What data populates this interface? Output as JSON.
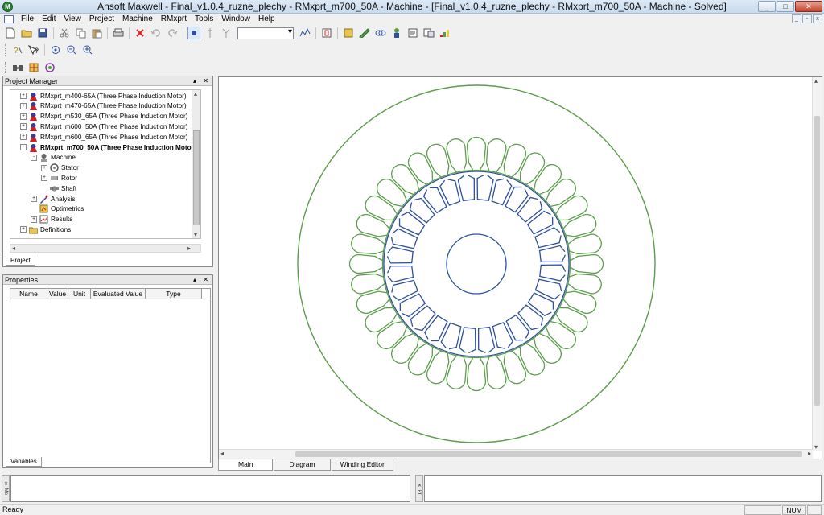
{
  "window": {
    "app_icon_letter": "M",
    "title": "Ansoft Maxwell  - Final_v1.0.4_ruzne_plechy - RMxprt_m700_50A - Machine - [Final_v1.0.4_ruzne_plechy - RMxprt_m700_50A - Machine - Solved]",
    "controls": {
      "minimize": "_",
      "maximize": "□",
      "close": "✕"
    }
  },
  "menu": {
    "items": [
      "File",
      "Edit",
      "View",
      "Project",
      "Machine",
      "RMxprt",
      "Tools",
      "Window",
      "Help"
    ],
    "mdi_controls": [
      "_",
      "▫",
      "x"
    ]
  },
  "project_manager": {
    "title": "Project Manager",
    "header_buttons": "▴ ✕",
    "tree": [
      {
        "label": "RMxprt_m400-65A (Three Phase Induction Motor)",
        "icon": "motor-design-icon",
        "toggle": "+",
        "level": 0
      },
      {
        "label": "RMxprt_m470-65A (Three Phase Induction Motor)",
        "icon": "motor-design-icon",
        "toggle": "+",
        "level": 0
      },
      {
        "label": "RMxprt_m530_65A (Three Phase Induction Motor)",
        "icon": "motor-design-icon",
        "toggle": "+",
        "level": 0
      },
      {
        "label": "RMxprt_m600_50A (Three Phase Induction Motor)",
        "icon": "motor-design-icon",
        "toggle": "+",
        "level": 0
      },
      {
        "label": "RMxprt_m600_65A (Three Phase Induction Motor)",
        "icon": "motor-design-icon",
        "toggle": "+",
        "level": 0
      },
      {
        "label": "RMxprt_m700_50A (Three Phase Induction Moto",
        "icon": "motor-design-icon",
        "toggle": "-",
        "level": 0,
        "bold": true
      },
      {
        "label": "Machine",
        "icon": "machine-icon",
        "toggle": "-",
        "level": 1
      },
      {
        "label": "Stator",
        "icon": "stator-icon",
        "toggle": "+",
        "level": 2
      },
      {
        "label": "Rotor",
        "icon": "rotor-icon",
        "toggle": "+",
        "level": 2
      },
      {
        "label": "Shaft",
        "icon": "shaft-icon",
        "toggle": "",
        "level": 2
      },
      {
        "label": "Analysis",
        "icon": "analysis-icon",
        "toggle": "+",
        "level": 1
      },
      {
        "label": "Optimetrics",
        "icon": "optimetrics-icon",
        "toggle": "",
        "level": 1
      },
      {
        "label": "Results",
        "icon": "results-icon",
        "toggle": "+",
        "level": 1
      },
      {
        "label": "Definitions",
        "icon": "folder-icon",
        "toggle": "+",
        "level": 0
      }
    ],
    "tab_label": "Project"
  },
  "properties": {
    "title": "Properties",
    "header_buttons": "▴ ✕",
    "columns": [
      "Name",
      "Value",
      "Unit",
      "Evaluated Value",
      "Type"
    ],
    "tab_label": "Variables"
  },
  "editor": {
    "tabs": [
      {
        "label": "Main",
        "active": true
      },
      {
        "label": "Diagram",
        "active": false
      },
      {
        "label": "Winding Editor",
        "active": false
      }
    ],
    "stator_color": "#5a9e4a",
    "rotor_color": "#2c4f9e",
    "stator_slots": 36,
    "rotor_slots": 28
  },
  "message_panel": {
    "side_label": "Me",
    "close": "✕"
  },
  "progress_panel": {
    "side_label": "Pr",
    "close": "✕"
  },
  "status": {
    "text": "Ready",
    "num": "NUM"
  }
}
